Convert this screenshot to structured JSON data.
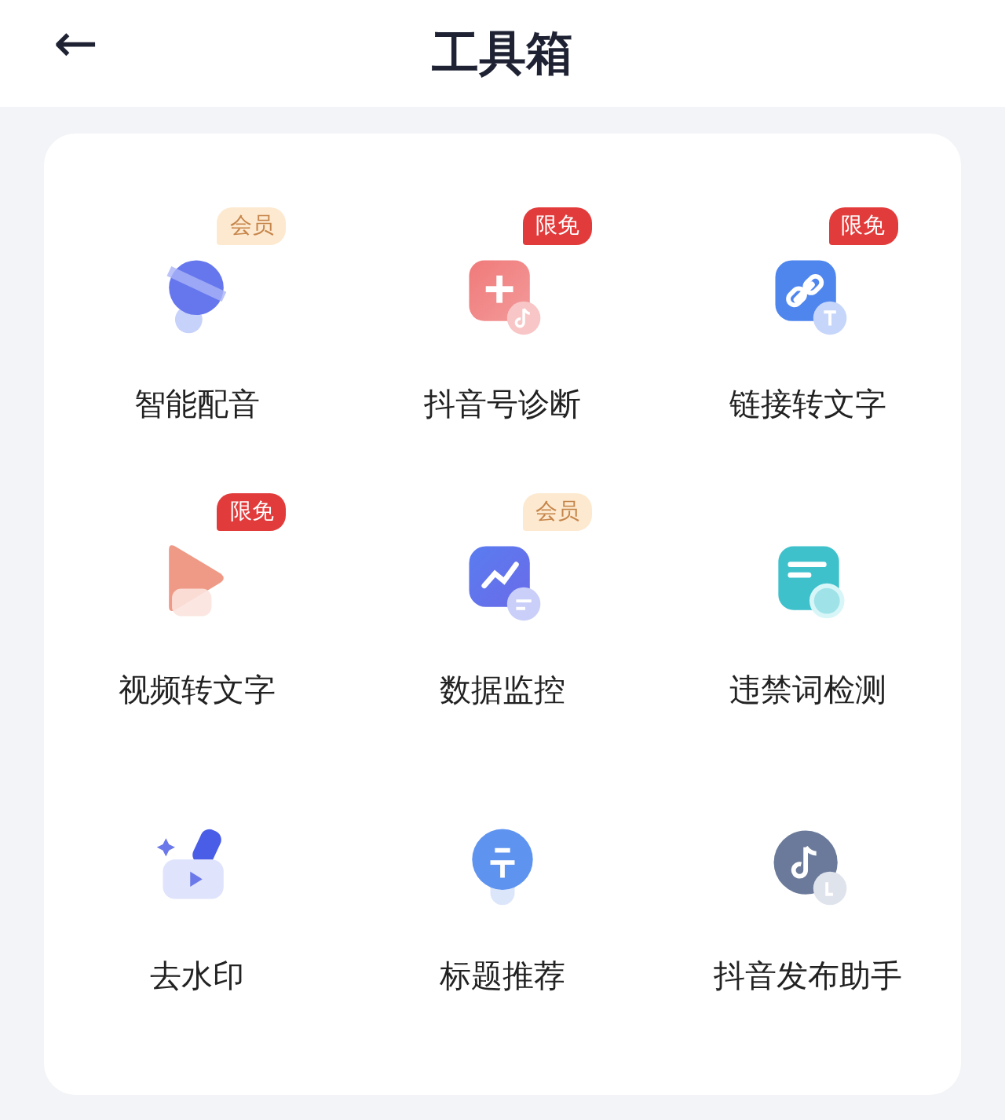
{
  "header": {
    "back_icon": "←",
    "title": "工具箱"
  },
  "tools": [
    {
      "label": "智能配音",
      "kind": "mic",
      "badge": {
        "kind": "member",
        "text": "会员"
      }
    },
    {
      "label": "抖音号诊断",
      "kind": "plus",
      "badge": {
        "kind": "free",
        "text": "限免"
      }
    },
    {
      "label": "链接转文字",
      "kind": "link",
      "badge": {
        "kind": "free",
        "text": "限免"
      }
    },
    {
      "label": "视频转文字",
      "kind": "play",
      "badge": {
        "kind": "free",
        "text": "限免"
      }
    },
    {
      "label": "数据监控",
      "kind": "chart",
      "badge": {
        "kind": "member",
        "text": "会员"
      }
    },
    {
      "label": "违禁词检测",
      "kind": "doc"
    },
    {
      "label": "去水印",
      "kind": "video"
    },
    {
      "label": "标题推荐",
      "kind": "title"
    },
    {
      "label": "抖音发布助手",
      "kind": "note"
    }
  ]
}
